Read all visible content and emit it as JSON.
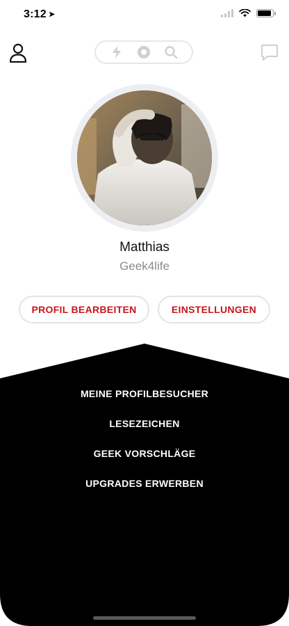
{
  "status_bar": {
    "time": "3:12",
    "location_icon": "location-arrow-icon",
    "signal_icon": "cellular-signal-icon",
    "wifi_icon": "wifi-icon",
    "battery_icon": "battery-icon",
    "battery_level": 0.9
  },
  "top_nav": {
    "profile_icon": "person-icon",
    "segments": [
      {
        "icon": "lightning-icon"
      },
      {
        "icon": "record-circle-icon"
      },
      {
        "icon": "search-icon"
      }
    ],
    "chat_icon": "chat-bubble-icon"
  },
  "profile": {
    "name": "Matthias",
    "username": "Geek4life"
  },
  "actions": {
    "edit_profile": "PROFIL BEARBEITEN",
    "settings": "EINSTELLUNGEN"
  },
  "menu": {
    "items": [
      {
        "label": "MEINE PROFILBESUCHER"
      },
      {
        "label": "LESEZEICHEN"
      },
      {
        "label": "GEEK VORSCHLÄGE"
      },
      {
        "label": "UPGRADES ERWERBEN"
      }
    ]
  },
  "colors": {
    "accent": "#c6161c",
    "panel": "#000000",
    "pill_border": "#e4e4e8"
  }
}
